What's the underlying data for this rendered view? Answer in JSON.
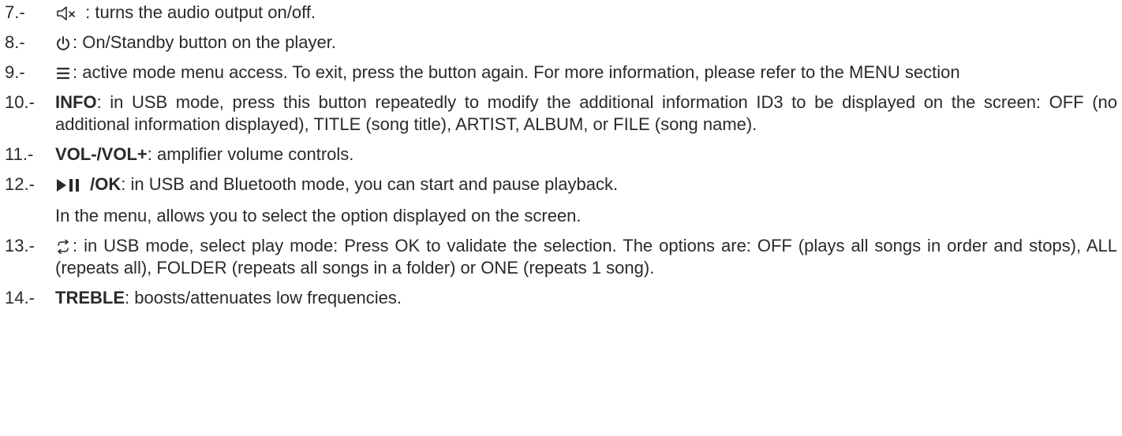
{
  "items": [
    {
      "num": "7.-",
      "icon": "speaker-mute-icon",
      "sep": " : ",
      "text": "turns the audio output on/off."
    },
    {
      "num": "8.-",
      "icon": "power-icon",
      "sep": ":",
      "text": " On/Standby button on the player."
    },
    {
      "num": "9.-",
      "icon": "menu-icon",
      "sep": ":",
      "text": " active mode menu access. To exit, press the button again. For more information, please refer to the MENU section"
    },
    {
      "num": "10.-",
      "term": "INFO",
      "text": ": in USB mode, press this button repeatedly to modify the additional information ID3 to be displayed on the screen: OFF (no additional information displayed), TITLE (song title), ARTIST, ALBUM, or FILE (song name)."
    },
    {
      "num": "11.-",
      "term": "VOL-/VOL+",
      "text": ": amplifier volume controls."
    },
    {
      "num": "12.-",
      "icon": "play-pause-icon",
      "term": " /OK",
      "text": ": in USB and Bluetooth mode, you can start and pause playback.",
      "continuation": "In the menu, allows you to select the option displayed on the screen."
    },
    {
      "num": "13.-",
      "icon": "repeat-icon",
      "sep": ":",
      "text": " in USB mode, select play mode: Press OK to validate the selection. The options are: OFF (plays all songs in order and stops), ALL (repeats all), FOLDER (repeats all songs in a folder) or ONE (repeats 1 song)."
    },
    {
      "num": "14.-",
      "term": "TREBLE",
      "text": ": boosts/attenuates low frequencies."
    }
  ]
}
